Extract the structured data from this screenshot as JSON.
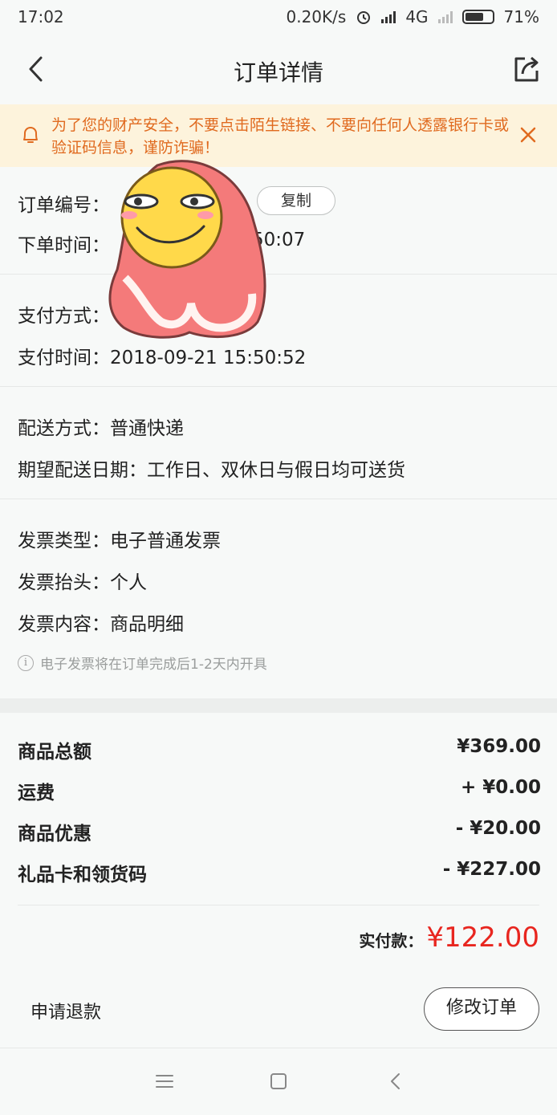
{
  "status_bar": {
    "time": "17:02",
    "network_speed": "0.20K/s",
    "network_type": "4G",
    "battery": "71%"
  },
  "nav": {
    "title": "订单详情",
    "back_icon": "chevron-left-icon",
    "share_icon": "share-icon"
  },
  "warning": {
    "text": "为了您的财产安全，不要点击陌生链接、不要向任何人透露银行卡或验证码信息，谨防诈骗！",
    "color": "#e06a1f",
    "background": "#fdf3dc"
  },
  "order": {
    "number_label": "订单编号：",
    "copy_label": "复制",
    "time_label": "下单时间：",
    "time_visible": "50:07"
  },
  "payment": {
    "method_label": "支付方式：",
    "time_label": "支付时间：",
    "time_value": "2018-09-21 15:50:52"
  },
  "delivery": {
    "method_label": "配送方式：",
    "method_value": "普通快递",
    "date_label": "期望配送日期：",
    "date_value": "工作日、双休日与假日均可送货"
  },
  "invoice": {
    "type_label": "发票类型：",
    "type_value": "电子普通发票",
    "title_label": "发票抬头：",
    "title_value": "个人",
    "content_label": "发票内容：",
    "content_value": "商品明细",
    "note": "电子发票将在订单完成后1-2天内开具"
  },
  "amounts": [
    {
      "label": "商品总额",
      "value": "¥369.00"
    },
    {
      "label": "运费",
      "value": "+ ¥0.00"
    },
    {
      "label": "商品优惠",
      "value": "- ¥20.00"
    },
    {
      "label": "礼品卡和领货码",
      "value": "- ¥227.00"
    }
  ],
  "total": {
    "label": "实付款：",
    "value": "¥122.00",
    "color": "#e8261f"
  },
  "actions": {
    "refund_label": "申请退款",
    "modify_label": "修改订单"
  }
}
